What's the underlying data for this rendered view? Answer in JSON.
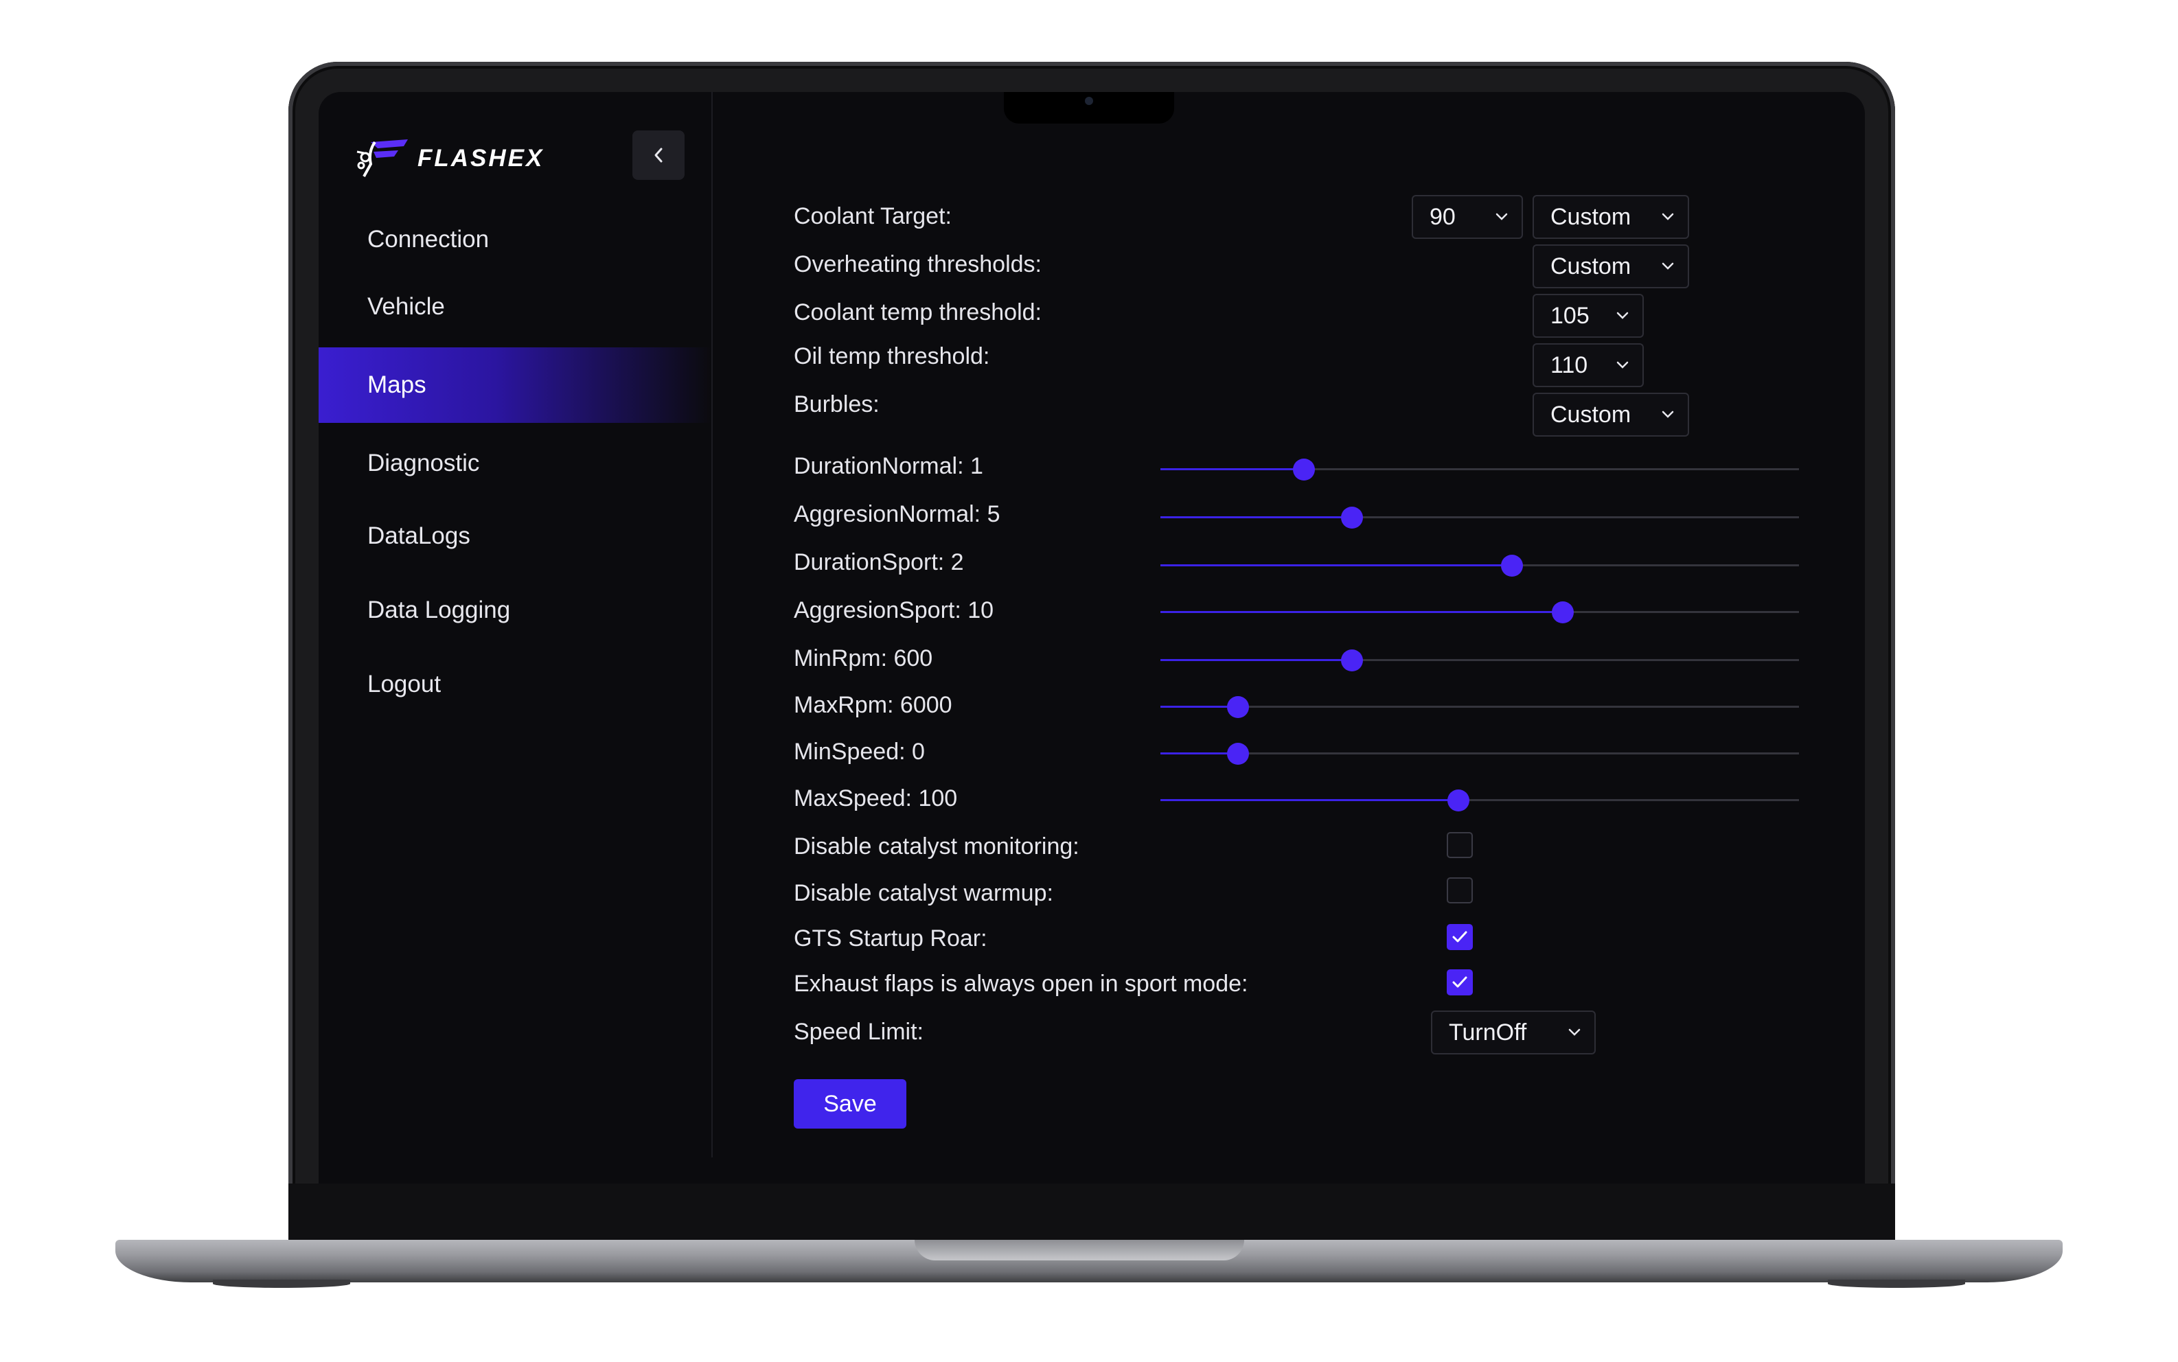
{
  "app": {
    "brand": "FLASHEX"
  },
  "sidebar": {
    "items": [
      {
        "label": "Connection"
      },
      {
        "label": "Vehicle"
      },
      {
        "label": "Maps",
        "active": true
      },
      {
        "label": "Diagnostic"
      },
      {
        "label": "DataLogs"
      },
      {
        "label": "Data Logging"
      },
      {
        "label": "Logout"
      }
    ]
  },
  "form": {
    "coolant_target": {
      "label": "Coolant Target:",
      "value": "90",
      "mode": "Custom"
    },
    "overheating": {
      "label": "Overheating thresholds:",
      "value": "Custom"
    },
    "coolant_temp": {
      "label": "Coolant temp threshold:",
      "value": "105"
    },
    "oil_temp": {
      "label": "Oil temp threshold:",
      "value": "110"
    },
    "burbles": {
      "label": "Burbles:",
      "value": "Custom"
    },
    "sliders": [
      {
        "label": "DurationNormal: 1",
        "level": 0.225
      },
      {
        "label": "AggresionNormal: 5",
        "level": 0.3
      },
      {
        "label": "DurationSport: 2",
        "level": 0.55
      },
      {
        "label": "AggresionSport: 10",
        "level": 0.63
      },
      {
        "label": "MinRpm: 600",
        "level": 0.3
      },
      {
        "label": "MaxRpm: 6000",
        "level": 0.122
      },
      {
        "label": "MinSpeed: 0",
        "level": 0.122
      },
      {
        "label": "MaxSpeed: 100",
        "level": 0.467
      }
    ],
    "checkboxes": [
      {
        "label": "Disable catalyst monitoring:",
        "checked": false
      },
      {
        "label": "Disable catalyst warmup:",
        "checked": false
      },
      {
        "label": "GTS Startup Roar:",
        "checked": true
      },
      {
        "label": "Exhaust flaps is always open in sport mode:",
        "checked": true
      }
    ],
    "speed_limit": {
      "label": "Speed Limit:",
      "value": "TurnOff"
    },
    "save_label": "Save"
  },
  "colors": {
    "accent": "#4a24f5",
    "background": "#0b0b0e"
  }
}
